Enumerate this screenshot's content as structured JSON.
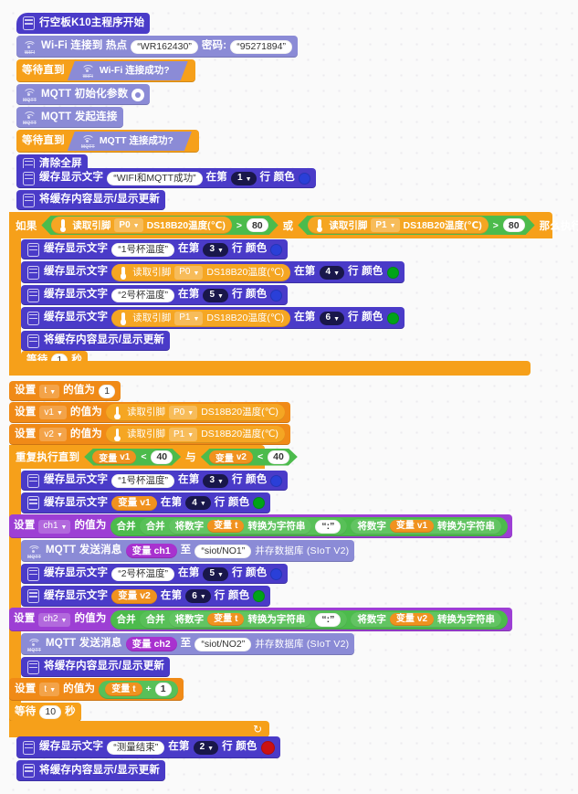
{
  "workspace": {
    "app": "block-programming-canvas",
    "language": "zh-CN",
    "colors": {
      "display_block": "#4a3bc8",
      "wifi_block": "#8b8bd6",
      "control_block": "#f6a01a",
      "variable_block": "#f08a17",
      "operator_block": "#4cbb4c",
      "set_var_purple": "#9d3fd4",
      "swatch_blue": "#2a3fd8",
      "swatch_green": "#00a318",
      "swatch_red": "#cc1111"
    }
  },
  "blocks": {
    "hat": {
      "label": "行空板K10主程序开始",
      "icon": "screen-icon"
    },
    "wifi_connect": {
      "label_a": "Wi-Fi 连接到 热点",
      "ssid": "“WR162430”",
      "label_b": "密码:",
      "password": "“95271894”",
      "icon": "wifi-icon"
    },
    "wait_until_wifi": {
      "label": "等待直到",
      "condition": "Wi-Fi 连接成功?",
      "icon": "wifi-icon"
    },
    "mqtt_init": {
      "label": "MQTT 初始化参数",
      "icon": "mqtt-icon",
      "gear": "gear-icon"
    },
    "mqtt_connect": {
      "label": "MQTT 发起连接",
      "icon": "mqtt-icon"
    },
    "wait_until_mqtt": {
      "label": "等待直到",
      "condition": "MQTT 连接成功?",
      "icon": "mqtt-icon"
    },
    "clear_screen": {
      "label": "清除全屏",
      "icon": "screen-icon"
    },
    "show_text_ok": {
      "label_a": "缓存显示文字",
      "text": "“WIFI和MQTT成功”",
      "label_b": "在第",
      "line": "1",
      "label_c": "行 颜色",
      "color": "#2a3fd8"
    },
    "refresh_1": {
      "label": "将缓存内容显示/显示更新"
    },
    "if_block": {
      "label_if": "如果",
      "label_then": "那么执行",
      "label_or": "或",
      "cond_a": {
        "read_label": "读取引脚",
        "pin": "P0",
        "sensor": "DS18B20温度(℃)",
        "op": ">",
        "value": "80"
      },
      "cond_b": {
        "read_label": "读取引脚",
        "pin": "P1",
        "sensor": "DS18B20温度(℃)",
        "op": ">",
        "value": "80"
      }
    },
    "if_body": {
      "row1": {
        "label_a": "缓存显示文字",
        "text": "“1号杯温度”",
        "label_b": "在第",
        "line": "3",
        "label_c": "行 颜色",
        "color": "#2a3fd8"
      },
      "row2": {
        "label_a": "缓存显示文字",
        "read_label": "读取引脚",
        "pin": "P0",
        "sensor": "DS18B20温度(℃)",
        "label_b": "在第",
        "line": "4",
        "label_c": "行 颜色",
        "color": "#00a318"
      },
      "row3": {
        "label_a": "缓存显示文字",
        "text": "“2号杯温度”",
        "label_b": "在第",
        "line": "5",
        "label_c": "行 颜色",
        "color": "#2a3fd8"
      },
      "row4": {
        "label_a": "缓存显示文字",
        "read_label": "读取引脚",
        "pin": "P1",
        "sensor": "DS18B20温度(℃)",
        "label_b": "在第",
        "line": "6",
        "label_c": "行 颜色",
        "color": "#00a318"
      },
      "row5": {
        "label": "将缓存内容显示/显示更新"
      },
      "row6": {
        "label_a": "等待",
        "value": "1",
        "label_b": "秒"
      }
    },
    "set_t": {
      "label_a": "设置",
      "var": "t",
      "label_b": "的值为",
      "value": "1"
    },
    "set_v1": {
      "label_a": "设置",
      "var": "v1",
      "label_b": "的值为",
      "read_label": "读取引脚",
      "pin": "P0",
      "sensor": "DS18B20温度(℃)"
    },
    "set_v2": {
      "label_a": "设置",
      "var": "v2",
      "label_b": "的值为",
      "read_label": "读取引脚",
      "pin": "P1",
      "sensor": "DS18B20温度(℃)"
    },
    "repeat_until": {
      "label": "重复执行直到",
      "label_and": "与",
      "cond_a": {
        "var_label": "变量",
        "var": "v1",
        "op": "<",
        "value": "40"
      },
      "cond_b": {
        "var_label": "变量",
        "var": "v2",
        "op": "<",
        "value": "40"
      }
    },
    "loop_body": {
      "row1": {
        "label_a": "缓存显示文字",
        "text": "“1号杯温度”",
        "label_b": "在第",
        "line": "3",
        "label_c": "行 颜色",
        "color": "#2a3fd8"
      },
      "row2": {
        "label_a": "缓存显示文字",
        "var_label": "变量",
        "var": "v1",
        "label_b": "在第",
        "line": "4",
        "label_c": "行 颜色",
        "color": "#00a318"
      },
      "row3": {
        "label_a": "设置",
        "var": "ch1",
        "label_b": "的值为",
        "join_1": "合并",
        "join_2": "合并",
        "tostr_1": "将数字",
        "v_t_label": "变量",
        "v_t": "t",
        "tostr_1b": "转换为字符串",
        "sep": "“:”",
        "tostr_2": "将数字",
        "v_v_label": "变量",
        "v_v": "v1",
        "tostr_2b": "转换为字符串"
      },
      "row4": {
        "label_a": "MQTT 发送消息",
        "var_label": "变量",
        "var": "ch1",
        "label_b": "至",
        "topic": "“siot/NO1”",
        "label_c": "并存数据库 (SIoT V2)"
      },
      "row5": {
        "label_a": "缓存显示文字",
        "text": "“2号杯温度”",
        "label_b": "在第",
        "line": "5",
        "label_c": "行 颜色",
        "color": "#2a3fd8"
      },
      "row6": {
        "label_a": "缓存显示文字",
        "var_label": "变量",
        "var": "v2",
        "label_b": "在第",
        "line": "6",
        "label_c": "行 颜色",
        "color": "#00a318"
      },
      "row7": {
        "label_a": "设置",
        "var": "ch2",
        "label_b": "的值为",
        "join_1": "合并",
        "join_2": "合并",
        "tostr_1": "将数字",
        "v_t_label": "变量",
        "v_t": "t",
        "tostr_1b": "转换为字符串",
        "sep": "“:”",
        "tostr_2": "将数字",
        "v_v_label": "变量",
        "v_v": "v2",
        "tostr_2b": "转换为字符串"
      },
      "row8": {
        "label_a": "MQTT 发送消息",
        "var_label": "变量",
        "var": "ch2",
        "label_b": "至",
        "topic": "“siot/NO2”",
        "label_c": "并存数据库 (SIoT V2)"
      },
      "row9": {
        "label": "将缓存内容显示/显示更新"
      },
      "row10": {
        "label_a": "设置",
        "var": "t",
        "label_b": "的值为",
        "var_label": "变量",
        "op_var": "t",
        "op": "+",
        "value": "1"
      },
      "row11": {
        "label_a": "等待",
        "value": "10",
        "label_b": "秒"
      }
    },
    "end_text": {
      "label_a": "缓存显示文字",
      "text": "“测量结束”",
      "label_b": "在第",
      "line": "2",
      "label_c": "行 颜色",
      "color": "#cc1111"
    },
    "refresh_last": {
      "label": "将缓存内容显示/显示更新"
    }
  }
}
